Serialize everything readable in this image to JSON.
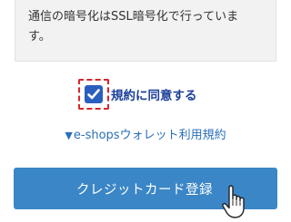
{
  "notice": {
    "line1": "通信の暗号化はSSL暗号化で行っていま",
    "line2": "す。"
  },
  "agreement": {
    "label": "規約に同意する",
    "checked": true
  },
  "terms_link": {
    "arrow": "▼",
    "label": "e-shopsウォレット利用規約"
  },
  "register_button": {
    "label": "クレジットカード登録"
  },
  "colors": {
    "checkbox": "#2a5fc0",
    "highlight": "#d8262b",
    "link": "#2a6fb8",
    "button": "#3b86c6"
  },
  "icons": {
    "checkbox": "checkmark-icon",
    "cursor": "hand-pointer-icon"
  }
}
